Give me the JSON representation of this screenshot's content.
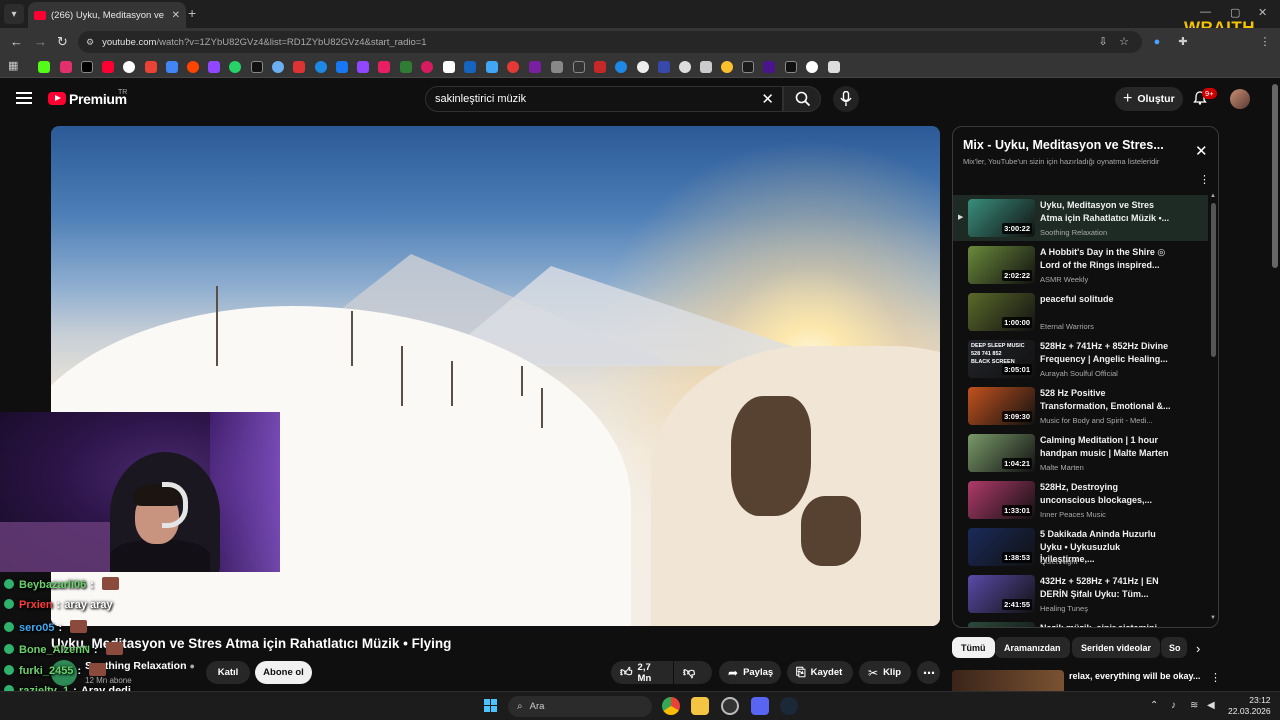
{
  "browser": {
    "tab_title": "(266) Uyku, Meditasyon ve Stres",
    "url_host": "youtube.com",
    "url_path": "/watch?v=1ZYbU82GVz4&list=RD1ZYbU82GVz4&start_radio=1",
    "overlay_brand": "WRAITH"
  },
  "header": {
    "brand": "Premium",
    "brand_suffix": "TR",
    "search_query": "sakinleştirici müzik",
    "create_label": "Oluştur",
    "notification_count": "9+"
  },
  "video": {
    "title": "Uyku, Meditasyon ve Stres Atma için Rahatlatıcı Müzik • Flying",
    "channel": "Soothing Relaxation",
    "subscribers": "12 Mn abone",
    "join_label": "Katıl",
    "subscribe_label": "Abone ol",
    "likes": "2,7 Mn",
    "share_label": "Paylaş",
    "save_label": "Kaydet",
    "clip_label": "Klip",
    "colors": {
      "sky": "#4e7fb7",
      "snow": "#f4eee6",
      "sun": "#ffe8aa"
    }
  },
  "playlist": {
    "title": "Mix - Uyku, Meditasyon ve Stres...",
    "subtitle": "Mix'ler, YouTube'un sizin için hazırladığı oynatma listeleridir",
    "items": [
      {
        "title": "Uyku, Meditasyon ve Stres Atma için Rahatlatıcı Müzik •...",
        "channel": "Soothing Relaxation",
        "duration": "3:00:22",
        "active": true,
        "thumb": "#3a8f7d"
      },
      {
        "title": "A Hobbit's Day in the Shire ◎ Lord of the Rings inspired...",
        "channel": "ASMR Weekly",
        "duration": "2:02:22",
        "thumb": "#6a8a3a"
      },
      {
        "title": "peaceful solitude",
        "channel": "Eternal Warriors",
        "duration": "1:00:00",
        "thumb": "#5a6a2a"
      },
      {
        "title": "528Hz + 741Hz + 852Hz Divine Frequency | Angelic Healing...",
        "channel": "Aurayah Soulful Official",
        "duration": "3:05:01",
        "thumb": "#22252b",
        "thumb_lines": [
          "DEEP SLEEP MUSIC",
          "528 741 852",
          "BLACK SCREEN"
        ]
      },
      {
        "title": "528 Hz Positive Transformation, Emotional &...",
        "channel": "Music for Body and Spirit - Medi...",
        "duration": "3:09:30",
        "thumb": "#c2521e"
      },
      {
        "title": "Calming Meditation | 1 hour handpan music | Malte Marten",
        "channel": "Malte Marten",
        "duration": "1:04:21",
        "thumb": "#7a9a6a"
      },
      {
        "title": "528Hz, Destroying unconscious blockages,...",
        "channel": "Inner Peaces Music",
        "duration": "1:33:01",
        "thumb": "#b03a6a"
      },
      {
        "title": "5 Dakikada Aninda Huzurlu Uyku • Uykusuzluk İyileştirme,...",
        "channel": "Quiet Night",
        "duration": "1:38:53",
        "thumb": "#1a2a5a"
      },
      {
        "title": "432Hz + 528Hz + 741Hz | EN DERİN Şifalı Uyku: Tüm...",
        "channel": "Healing Tuneş",
        "duration": "2:41:55",
        "thumb": "#5a4aa8"
      },
      {
        "title": "Nazik müzik, sinir sistemini",
        "channel": "",
        "duration": "",
        "thumb": "#2a4a3a"
      }
    ]
  },
  "chips": [
    "Tümü",
    "Aramanızdan",
    "Seriden videolar",
    "So"
  ],
  "recommendation": {
    "title": "relax, everything will be okay..."
  },
  "chat": [
    {
      "user": "Beybazarli06",
      "sep": ":",
      "msg": "",
      "color": "#6bd36b"
    },
    {
      "user": "Prxien",
      "sep": ":",
      "msg": "aray aray",
      "color": "#ff3b3b"
    },
    {
      "user": "sero05",
      "sep": ":",
      "msg": "",
      "color": "#3fa9f5"
    },
    {
      "user": "Bone_AlzenN",
      "sep": ":",
      "msg": "",
      "color": "#6bd36b"
    },
    {
      "user": "furki_2455",
      "sep": ":",
      "msg": "",
      "color": "#6bd36b"
    },
    {
      "user": "razieltv_1",
      "sep": ":",
      "msg": "Aray dedi",
      "color": "#6bd36b"
    },
    {
      "user": "betul_chan",
      "sep": ":",
      "msg": "",
      "color": "#ffffff"
    }
  ],
  "taskbar": {
    "search_label": "Ara",
    "time": "23:12",
    "date": "22.03.2026"
  }
}
